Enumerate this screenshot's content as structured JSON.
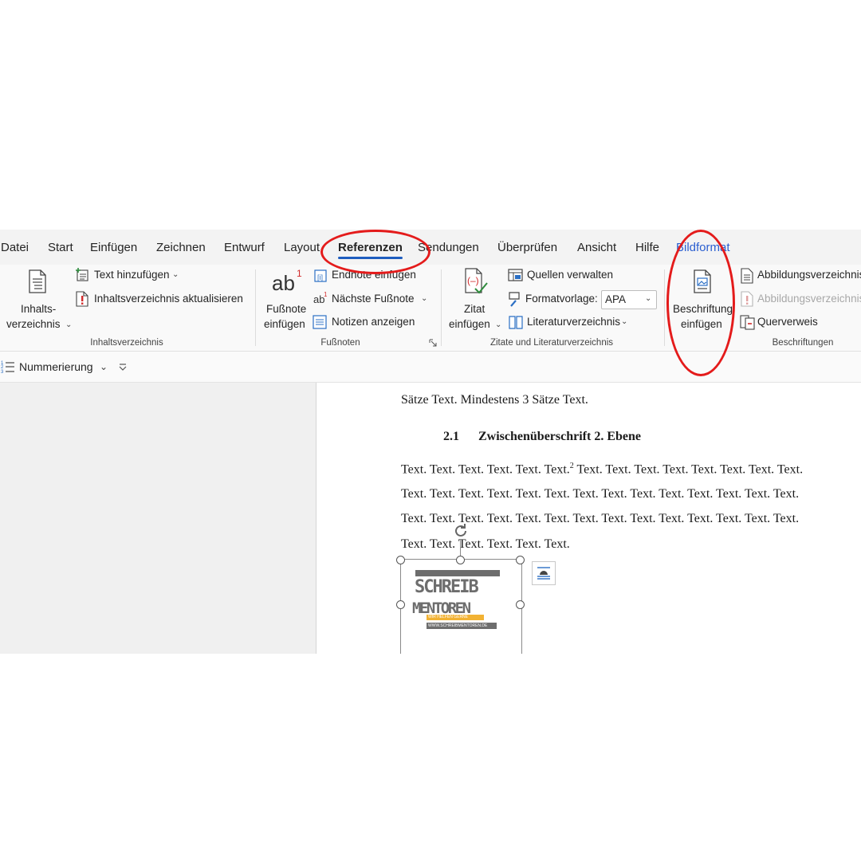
{
  "tabs": [
    "Datei",
    "Start",
    "Einfügen",
    "Zeichnen",
    "Entwurf",
    "Layout",
    "Referenzen",
    "Sendungen",
    "Überprüfen",
    "Ansicht",
    "Hilfe",
    "Bildformat"
  ],
  "active_tab": "Referenzen",
  "ribbon": {
    "toc": {
      "main_line1": "Inhalts-",
      "main_line2": "verzeichnis",
      "add_text": "Text hinzufügen",
      "update": "Inhaltsverzeichnis aktualisieren",
      "group": "Inhaltsverzeichnis"
    },
    "footnotes": {
      "insert_line1": "Fußnote",
      "insert_line2": "einfügen",
      "endnote": "Endnote einfügen",
      "next": "Nächste Fußnote",
      "show_notes": "Notizen anzeigen",
      "group": "Fußnoten"
    },
    "citations": {
      "insert_line1": "Zitat",
      "insert_line2": "einfügen",
      "manage": "Quellen verwalten",
      "style_label": "Formatvorlage:",
      "style_value": "APA",
      "bibliography": "Literaturverzeichnis",
      "group": "Zitate und Literaturverzeichnis"
    },
    "captions": {
      "insert_line1": "Beschriftung",
      "insert_line2": "einfügen",
      "table_of_figures": "Abbildungsverzeichnis",
      "update_table": "Abbildungsverzeichnis",
      "cross_ref": "Querverweis",
      "group": "Beschriftungen"
    }
  },
  "qat": {
    "numbering": "Nummerierung"
  },
  "document": {
    "line0": "Sätze Text. Mindestens 3 Sätze Text.",
    "heading_num": "2.1",
    "heading_text": "Zwischenüberschrift 2. Ebene",
    "para_line1_a": "Text. Text. Text. Text. Text. Text.",
    "para_line1_sup": "2",
    "para_line1_b": " Text. Text. Text. Text. Text. Text. Text. Text.",
    "para_line2": "Text. Text. Text. Text. Text. Text. Text. Text. Text. Text. Text. Text. Text. Text.",
    "para_line3": "Text. Text. Text. Text. Text. Text. Text. Text. Text. Text. Text. Text. Text. Text.",
    "para_line4": "Text. Text. Text. Text. Text. Text."
  },
  "logo": {
    "line1": "SCHREIB",
    "line2": "MENTOREN",
    "tagline": "WIR HELFEN GERNE",
    "url": "WWW.SCHREIBMENTOREN.DE"
  },
  "colors": {
    "annotation": "#e41b1b",
    "active_tab_underline": "#1f5dbf",
    "context_tab": "#2b5fd0"
  }
}
